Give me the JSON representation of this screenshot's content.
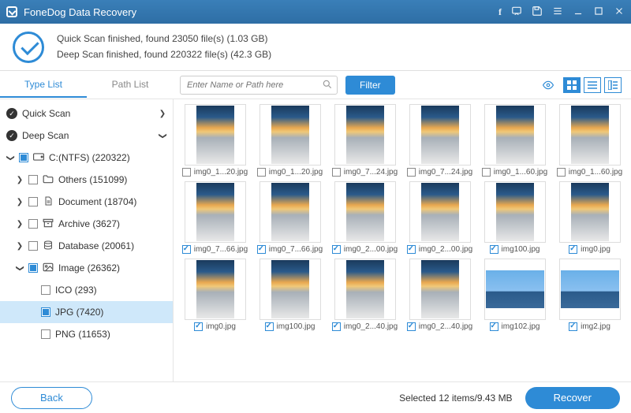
{
  "app": {
    "title": "FoneDog Data Recovery"
  },
  "status": {
    "quick": "Quick Scan finished, found 23050 file(s) (1.03 GB)",
    "deep": "Deep Scan finished, found 220322 file(s) (42.3 GB)"
  },
  "tabs": {
    "typeList": "Type List",
    "pathList": "Path List"
  },
  "search": {
    "placeholder": "Enter Name or Path here"
  },
  "filter": {
    "label": "Filter"
  },
  "sidebar": {
    "quickScan": "Quick Scan",
    "deepScan": "Deep Scan",
    "drive": "C:(NTFS) (220322)",
    "others": "Others (151099)",
    "document": "Document (18704)",
    "archive": "Archive (3627)",
    "database": "Database (20061)",
    "image": "Image (26362)",
    "ico": "ICO (293)",
    "jpg": "JPG (7420)",
    "png": "PNG (11653)"
  },
  "grid": [
    {
      "name": "img0_1...20.jpg",
      "checked": false,
      "variant": "sky"
    },
    {
      "name": "img0_1...20.jpg",
      "checked": false,
      "variant": "sky"
    },
    {
      "name": "img0_7...24.jpg",
      "checked": false,
      "variant": "sky"
    },
    {
      "name": "img0_7...24.jpg",
      "checked": false,
      "variant": "sky"
    },
    {
      "name": "img0_1...60.jpg",
      "checked": false,
      "variant": "sky"
    },
    {
      "name": "img0_1...60.jpg",
      "checked": false,
      "variant": "sky"
    },
    {
      "name": "img0_7...66.jpg",
      "checked": true,
      "variant": "sky"
    },
    {
      "name": "img0_7...66.jpg",
      "checked": true,
      "variant": "sky"
    },
    {
      "name": "img0_2...00.jpg",
      "checked": true,
      "variant": "sky"
    },
    {
      "name": "img0_2...00.jpg",
      "checked": true,
      "variant": "sky"
    },
    {
      "name": "img100.jpg",
      "checked": true,
      "variant": "sky"
    },
    {
      "name": "img0.jpg",
      "checked": true,
      "variant": "sky"
    },
    {
      "name": "img0.jpg",
      "checked": true,
      "variant": "sky"
    },
    {
      "name": "img100.jpg",
      "checked": true,
      "variant": "sky"
    },
    {
      "name": "img0_2...40.jpg",
      "checked": true,
      "variant": "sky"
    },
    {
      "name": "img0_2...40.jpg",
      "checked": true,
      "variant": "sky"
    },
    {
      "name": "img102.jpg",
      "checked": true,
      "variant": "island"
    },
    {
      "name": "img2.jpg",
      "checked": true,
      "variant": "island"
    }
  ],
  "footer": {
    "back": "Back",
    "recover": "Recover",
    "selected": "Selected 12 items/9.43 MB"
  }
}
